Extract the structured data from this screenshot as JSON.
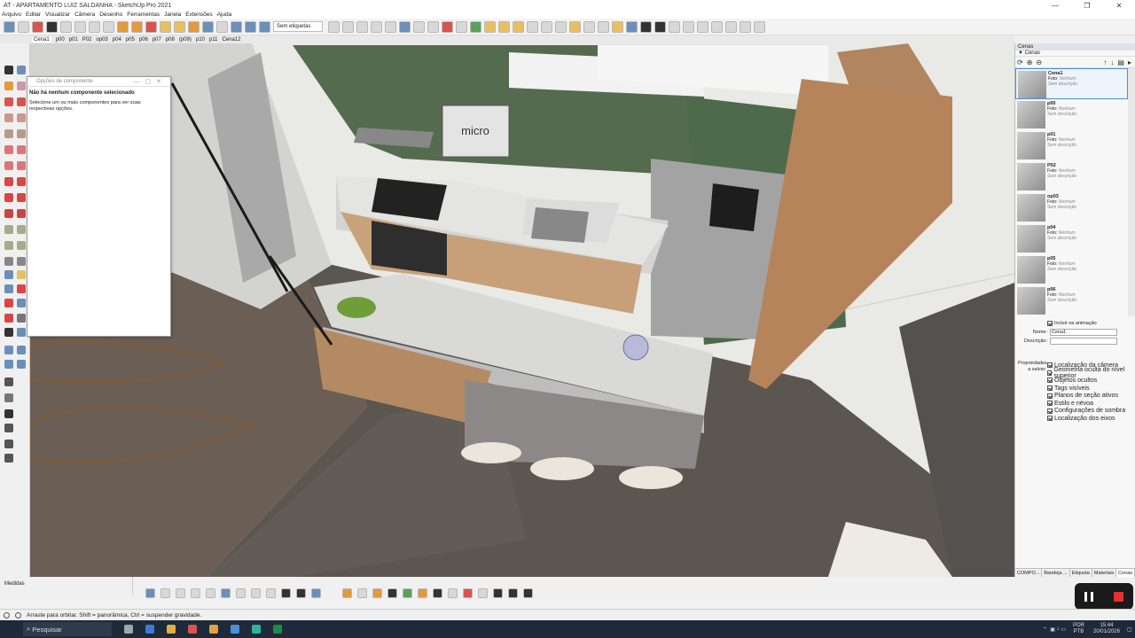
{
  "window": {
    "title": "AT - APARTAMENTO LUIZ SALDANHA - SketchUp Pro 2021",
    "controls": [
      "—",
      "❐",
      "✕"
    ]
  },
  "menu": [
    "Arquivo",
    "Editar",
    "Visualizar",
    "Câmera",
    "Desenho",
    "Ferramentas",
    "Janela",
    "Extensões",
    "Ajuda"
  ],
  "toolbar": {
    "tag_select": "Sem etiquetas"
  },
  "scene_tabs": [
    "Cena1",
    "p00",
    "p01",
    "P02",
    "op03",
    "p04",
    "p05",
    "p06",
    "p07",
    "p08",
    "(p09)",
    "p10",
    "p11",
    "Cena12"
  ],
  "dialog": {
    "title": "Opções de componente",
    "heading": "Não há nenhum componente selecionado",
    "body": "Selecione um ou mais componentes para ver suas respectivas opções."
  },
  "viewport": {
    "label_micro": "micro"
  },
  "panel": {
    "header": "Cenas",
    "subheader": "▼ Cenas",
    "scenes": [
      {
        "name": "Cena1",
        "foto": "Foto:",
        "foto_val": "Nenhum",
        "desc": "Sem descrição"
      },
      {
        "name": "p00",
        "foto": "Foto:",
        "foto_val": "Nenhum",
        "desc": "Sem descrição"
      },
      {
        "name": "p01",
        "foto": "Foto:",
        "foto_val": "Nenhum",
        "desc": "Sem descrição"
      },
      {
        "name": "P02",
        "foto": "Foto:",
        "foto_val": "Nenhum",
        "desc": "Sem descrição"
      },
      {
        "name": "op03",
        "foto": "Foto:",
        "foto_val": "Nenhum",
        "desc": "Sem descrição"
      },
      {
        "name": "p04",
        "foto": "Foto:",
        "foto_val": "Nenhum",
        "desc": "Sem descrição"
      },
      {
        "name": "p05",
        "foto": "Foto:",
        "foto_val": "Nenhum",
        "desc": "Sem descrição"
      },
      {
        "name": "p06",
        "foto": "Foto:",
        "foto_val": "Nenhum",
        "desc": "Sem descrição"
      }
    ],
    "include_anim": "Incluir na animação",
    "name_label": "Nome:",
    "name_value": "Cena1",
    "desc_label": "Descrição:",
    "desc_value": "",
    "props_label": "Propriedades a salvar:",
    "props": [
      "Localização da câmera",
      "Geometria oculta do nível superior",
      "Objetos ocultos",
      "Tags visíveis",
      "Planos de seção ativos",
      "Estilo e névoa",
      "Configurações de sombra",
      "Localização dos eixos"
    ],
    "tabs": [
      "COMPO...",
      "Bandeja ...",
      "Etiqueta",
      "Materiais",
      "Cenas"
    ]
  },
  "measure_label": "Medidas",
  "status_text": "Arraste para orbitar. Shift = panorâmica, Ctrl = suspender gravidade.",
  "taskbar": {
    "search": "Pesquisar",
    "lang1": "POR",
    "lang2": "PTB",
    "time": "15:44",
    "date": "20/01/2026"
  }
}
